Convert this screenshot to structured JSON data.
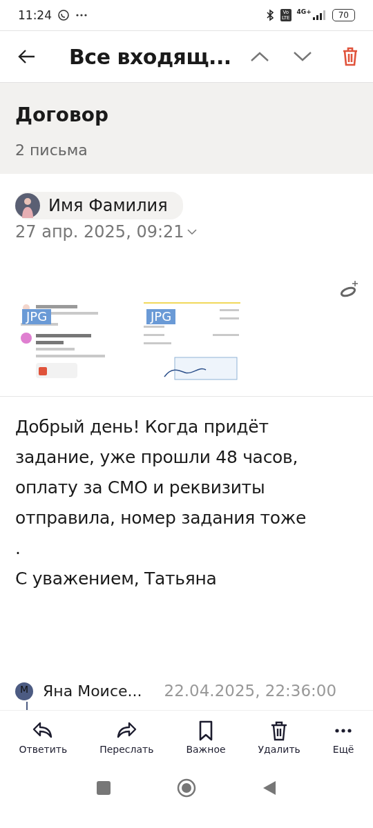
{
  "status_bar": {
    "time": "11:24",
    "network": "4G+",
    "volte": [
      "Vo",
      "LTE"
    ],
    "battery": "70"
  },
  "header": {
    "title": "Все входящ..."
  },
  "thread": {
    "subject": "Договор",
    "count": "2 письма"
  },
  "message": {
    "sender": "Имя Фамилия",
    "date": "27 апр. 2025, 09:21",
    "attachments": [
      {
        "kind": "picture",
        "badge": "JPG"
      },
      {
        "kind": "picture",
        "badge": "JPG"
      }
    ],
    "body_lines": [
      "Добрый день! Когда придёт",
      "задание, уже прошли 48 часов,",
      "оплату за СМО и реквизиты",
      "отправила, номер задания тоже",
      ".",
      "С уважением, Татьяна"
    ]
  },
  "next_message": {
    "initial": "М",
    "sender": "Яна Моисе...",
    "date": "22.04.2025, 22:36:00"
  },
  "actions": [
    {
      "kind": "reply",
      "label": "Ответить"
    },
    {
      "kind": "forward",
      "label": "Переслать"
    },
    {
      "kind": "bookmark",
      "label": "Важное"
    },
    {
      "kind": "delete",
      "label": "Удалить"
    },
    {
      "kind": "more",
      "label": "Ещё"
    }
  ]
}
